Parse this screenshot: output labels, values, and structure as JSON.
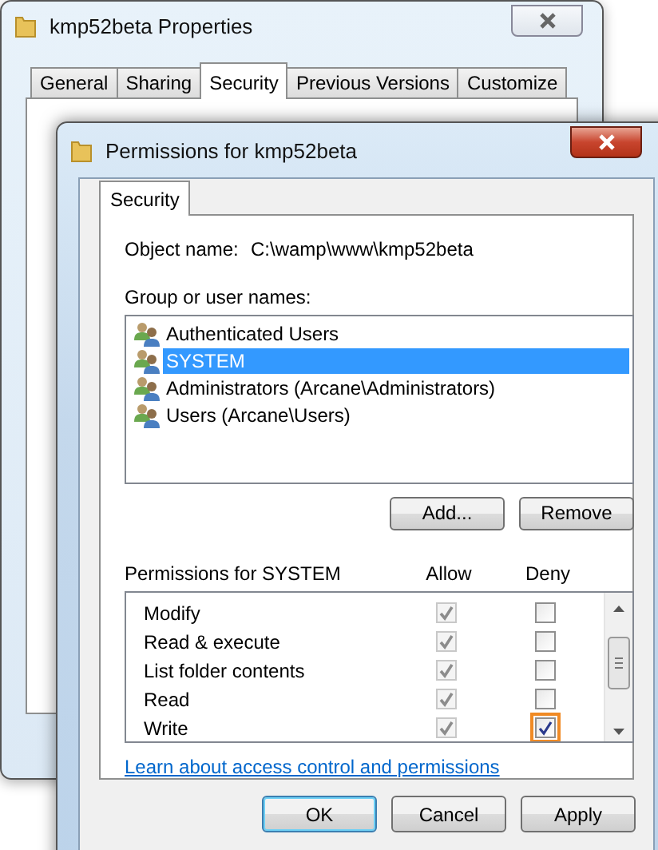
{
  "back_window": {
    "title": "kmp52beta Properties",
    "tabs": [
      {
        "label": "General",
        "selected": false
      },
      {
        "label": "Sharing",
        "selected": false
      },
      {
        "label": "Security",
        "selected": true
      },
      {
        "label": "Previous Versions",
        "selected": false
      },
      {
        "label": "Customize",
        "selected": false
      }
    ]
  },
  "window": {
    "title": "Permissions for kmp52beta",
    "tabs": [
      {
        "label": "Security",
        "selected": true
      }
    ],
    "object_name_label": "Object name:",
    "object_name": "C:\\wamp\\www\\kmp52beta",
    "group_label": "Group or user names:",
    "users": [
      {
        "name": "Authenticated Users",
        "selected": false
      },
      {
        "name": "SYSTEM",
        "selected": true
      },
      {
        "name": "Administrators (Arcane\\Administrators)",
        "selected": false
      },
      {
        "name": "Users (Arcane\\Users)",
        "selected": false
      }
    ],
    "user_buttons": [
      "Add...",
      "Remove"
    ],
    "permissions_label": "Permissions for SYSTEM",
    "allow_header": "Allow",
    "deny_header": "Deny",
    "permissions": [
      {
        "name": "Modify",
        "allow": true,
        "allow_disabled": true,
        "deny": false,
        "highlighted": false
      },
      {
        "name": "Read & execute",
        "allow": true,
        "allow_disabled": true,
        "deny": false,
        "highlighted": false
      },
      {
        "name": "List folder contents",
        "allow": true,
        "allow_disabled": true,
        "deny": false,
        "highlighted": false
      },
      {
        "name": "Read",
        "allow": true,
        "allow_disabled": true,
        "deny": false,
        "highlighted": false
      },
      {
        "name": "Write",
        "allow": true,
        "allow_disabled": true,
        "deny": true,
        "highlighted": true
      }
    ],
    "link": "Learn about access control and permissions",
    "buttons": [
      {
        "label": "OK",
        "default": true
      },
      {
        "label": "Cancel",
        "default": false
      },
      {
        "label": "Apply",
        "default": false
      }
    ]
  }
}
